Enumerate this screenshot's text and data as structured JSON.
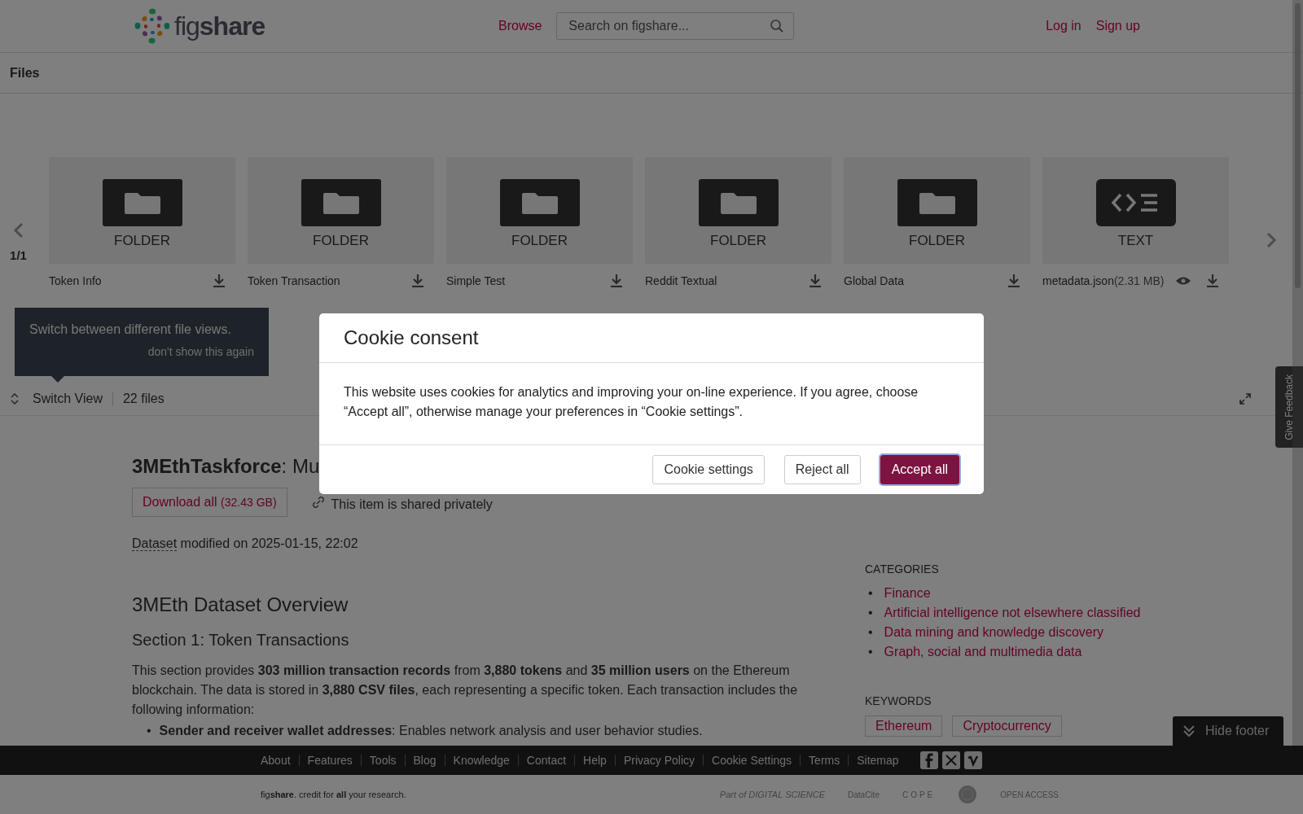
{
  "header": {
    "logo": "fig**share**",
    "browse": "Browse",
    "search": {
      "placeholder": "Search on figshare..."
    },
    "auth": [
      "Log in",
      "Sign up"
    ]
  },
  "files_bar": {
    "title": "Files"
  },
  "carousel": {
    "page": "1/1",
    "files": [
      {
        "kind": "folder",
        "type_label": "FOLDER",
        "name": "Token Info"
      },
      {
        "kind": "folder",
        "type_label": "FOLDER",
        "name": "Token Transaction"
      },
      {
        "kind": "folder",
        "type_label": "FOLDER",
        "name": "Simple Test"
      },
      {
        "kind": "folder",
        "type_label": "FOLDER",
        "name": "Reddit Textual"
      },
      {
        "kind": "folder",
        "type_label": "FOLDER",
        "name": "Global Data"
      },
      {
        "kind": "text",
        "type_label": "TEXT",
        "name": "metadata.json",
        "size": "(2.31 MB)"
      }
    ]
  },
  "tooltip": {
    "text": "Switch between different file views.",
    "dismiss": "don't show this again"
  },
  "view_bar": {
    "switch": "Switch View",
    "count": "22 files"
  },
  "article": {
    "title": "**3MEthTaskforce**: Mu",
    "download": "Download all",
    "download_size": "(32.43 GB)",
    "shared": "This item is shared privately",
    "type": "Dataset",
    "modified": "modified on 2025-01-15, 22:02",
    "heading": "3MEth Dataset Overview",
    "section": "Section 1: Token Transactions",
    "paragraph": "This section provides **303 million transaction records** from **3,880 tokens** and **35 million users** on the Ethereum blockchain. The data is stored in **3,880 CSV files**, each representing a specific token. Each transaction includes the following information:",
    "bullet_marker": "•",
    "bullet": "**Sender and receiver wallet addresses**: Enables network analysis and user behavior studies."
  },
  "sidebar": {
    "categories_title": "CATEGORIES",
    "marker": "•",
    "categories": [
      "Finance",
      "Artificial intelligence not elsewhere classified",
      "Data mining and knowledge discovery",
      "Graph, social and multimedia data"
    ],
    "keywords_title": "KEYWORDS",
    "keywords": [
      "Ethereum",
      "Cryptocurrency"
    ]
  },
  "feedback": "Give Feedback",
  "hide_footer": "Hide footer",
  "footer": {
    "links": [
      "About",
      "Features",
      "Tools",
      "Blog",
      "Knowledge",
      "Contact",
      "Help",
      "Privacy Policy",
      "Cookie Settings",
      "Terms",
      "Sitemap"
    ],
    "tagline": "fig**share**. credit for **all** your research.",
    "partners": [
      {
        "kind": "digital-science",
        "text": "Part of DIGITAL SCIENCE"
      },
      {
        "kind": "datacite",
        "text": "DataCite"
      },
      {
        "kind": "cope",
        "text": "COPE"
      },
      {
        "kind": "seal"
      },
      {
        "kind": "open-access",
        "text": "OPEN ACCESS"
      }
    ]
  },
  "cookie_modal": {
    "title": "Cookie consent",
    "body": "This website uses cookies for analytics and improving your on-line experience. If you agree, choose “Accept all”, otherwise manage your preferences in “Cookie settings”.",
    "buttons": [
      {
        "label": "Cookie settings",
        "kind": "secondary"
      },
      {
        "label": "Reject all",
        "kind": "secondary"
      },
      {
        "label": "Accept all",
        "kind": "primary"
      }
    ]
  }
}
